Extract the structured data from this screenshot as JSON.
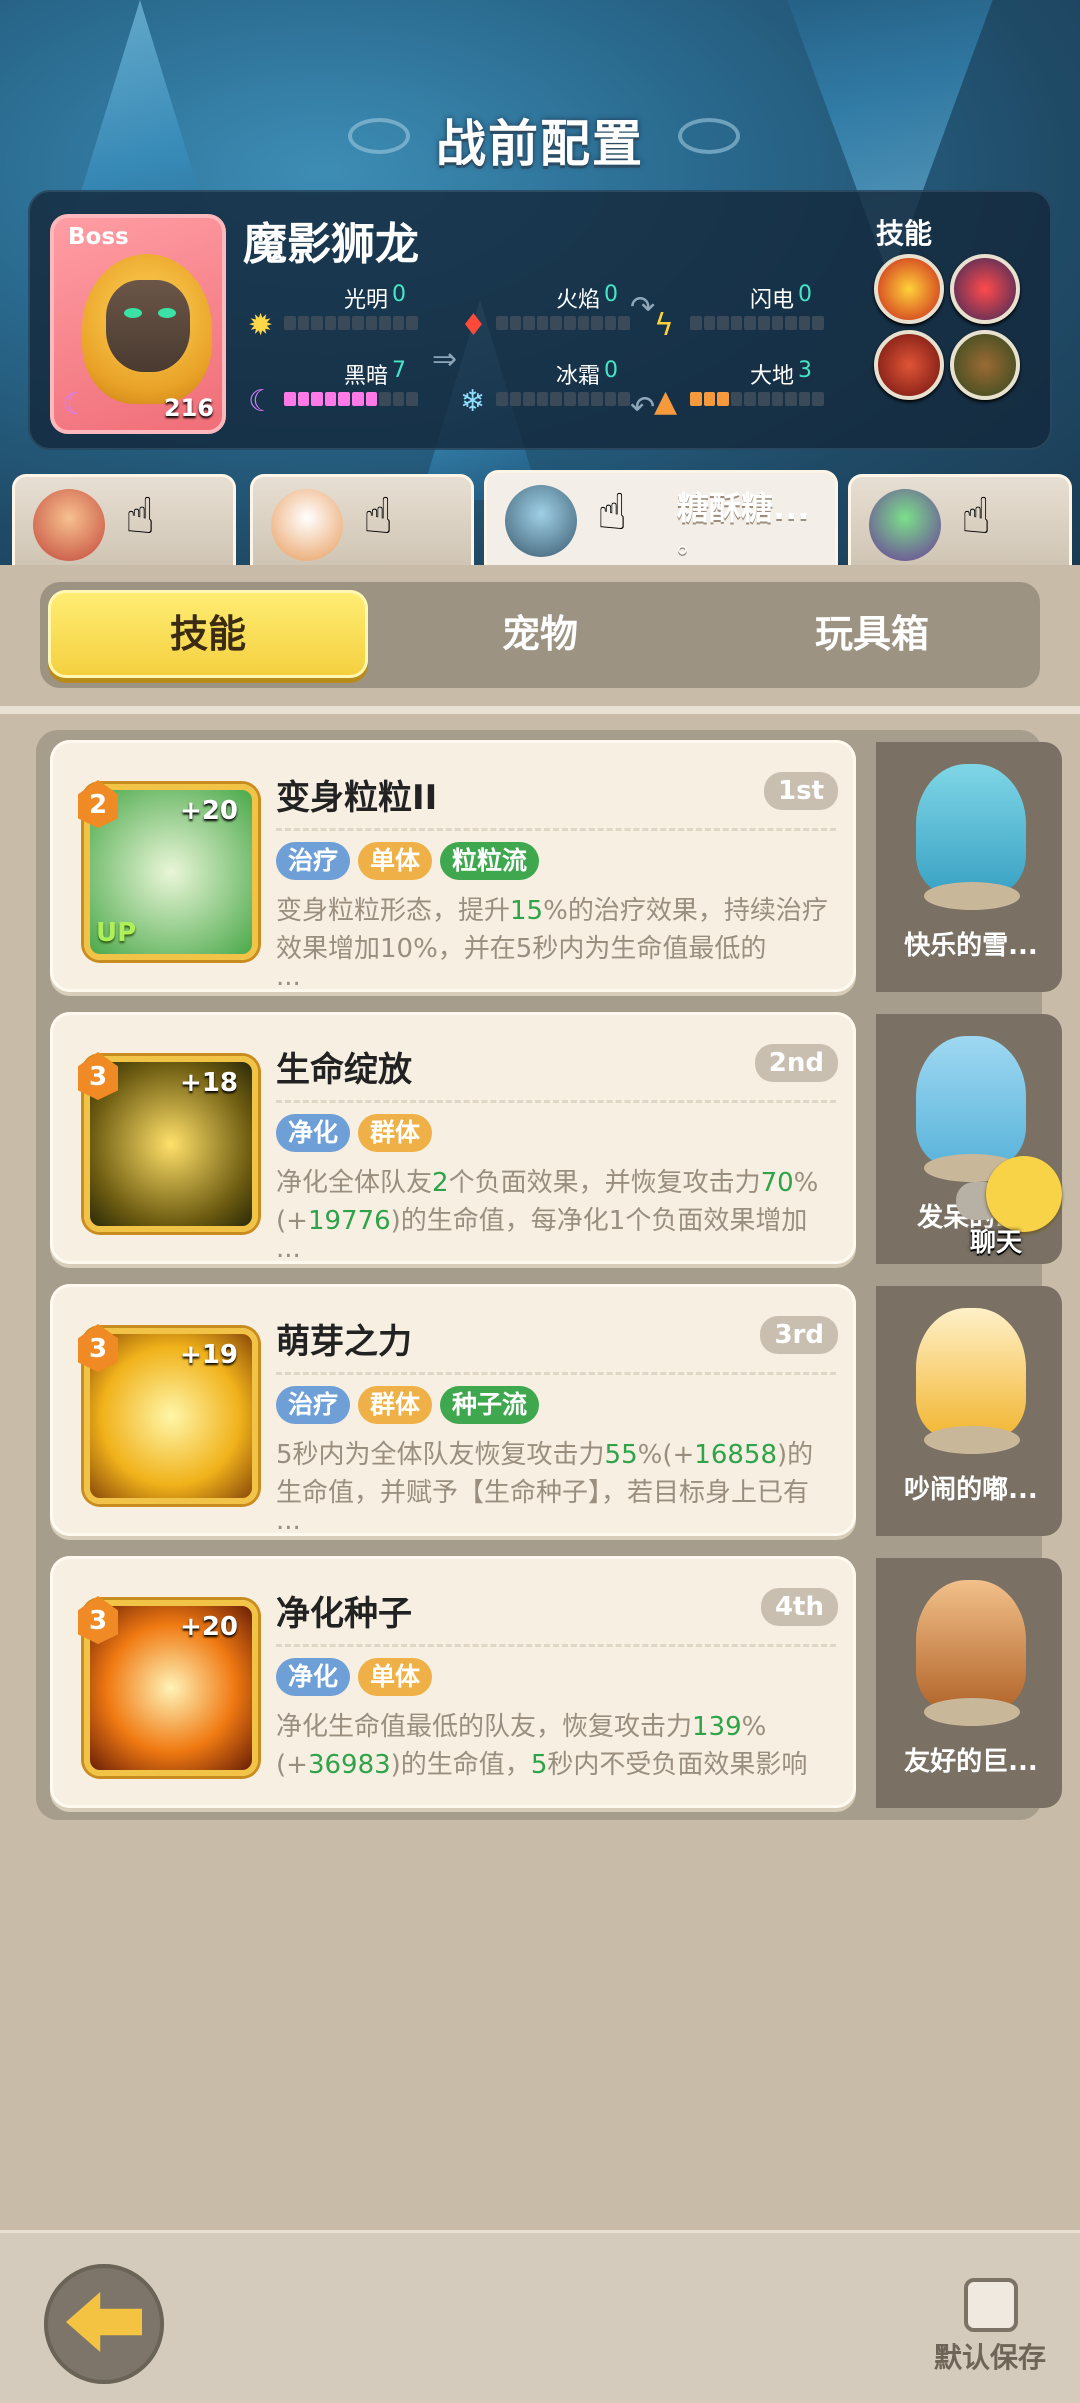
{
  "header": {
    "title": "战前配置"
  },
  "boss": {
    "tag": "Boss",
    "name": "魔影狮龙",
    "level": "216",
    "skills_label": "技能",
    "elements": [
      {
        "label": "光明",
        "value": "0",
        "icon": "sun-icon",
        "fill": 0
      },
      {
        "label": "火焰",
        "value": "0",
        "icon": "fire-icon",
        "fill": 0
      },
      {
        "label": "闪电",
        "value": "0",
        "icon": "lightning-icon",
        "fill": 0
      },
      {
        "label": "黑暗",
        "value": "7",
        "icon": "moon-icon",
        "fill": 7
      },
      {
        "label": "冰霜",
        "value": "0",
        "icon": "snowflake-icon",
        "fill": 0
      },
      {
        "label": "大地",
        "value": "3",
        "icon": "mountain-icon",
        "fill": 3
      }
    ]
  },
  "team": [
    {
      "name": ""
    },
    {
      "name": ""
    },
    {
      "name": "糖酥糖...",
      "sub": "。"
    },
    {
      "name": ""
    }
  ],
  "tabs": [
    {
      "label": "技能"
    },
    {
      "label": "宠物"
    },
    {
      "label": "玩具箱"
    }
  ],
  "skills": [
    {
      "title": "变身粒粒II",
      "rank": "1st",
      "level": "2",
      "plus": "+20",
      "up": "UP",
      "tags": [
        {
          "label": "治疗",
          "color": "blue"
        },
        {
          "label": "单体",
          "color": "orange"
        },
        {
          "label": "粒粒流",
          "color": "green"
        }
      ],
      "desc": [
        "变身粒粒形态，提升",
        "15",
        "%的治疗效果，持续治疗效果增加10%，并在5秒内为生命值最低的"
      ],
      "pet": "快乐的雪..."
    },
    {
      "title": "生命绽放",
      "rank": "2nd",
      "level": "3",
      "plus": "+18",
      "up": "",
      "tags": [
        {
          "label": "净化",
          "color": "blue"
        },
        {
          "label": "群体",
          "color": "orange"
        }
      ],
      "desc": [
        "净化全体队友",
        "2",
        "个负面效果，并恢复攻击力",
        "70",
        "%(+",
        "19776",
        ")的生命值，每净化1个负面效果增加"
      ],
      "pet": "发呆的..."
    },
    {
      "title": "萌芽之力",
      "rank": "3rd",
      "level": "3",
      "plus": "+19",
      "up": "",
      "tags": [
        {
          "label": "治疗",
          "color": "blue"
        },
        {
          "label": "群体",
          "color": "orange"
        },
        {
          "label": "种子流",
          "color": "green"
        }
      ],
      "desc": [
        "5秒内为全体队友恢复攻击力",
        "55",
        "%(+",
        "16858",
        ")的生命值，并赋予【生命种子】，若目标身上已有"
      ],
      "pet": "吵闹的嘟..."
    },
    {
      "title": "净化种子",
      "rank": "4th",
      "level": "3",
      "plus": "+20",
      "up": "",
      "tags": [
        {
          "label": "净化",
          "color": "blue"
        },
        {
          "label": "单体",
          "color": "orange"
        }
      ],
      "desc": [
        "净化生命值最低的队友，恢复攻击力",
        "139",
        "%(+",
        "36983",
        ")的生命值，",
        "5",
        "秒内不受负面效果影响"
      ],
      "pet": "友好的巨..."
    }
  ],
  "chat": {
    "label": "聊天"
  },
  "bottom": {
    "save_label": "默认保存"
  },
  "ellipsis": "...",
  "colors": {
    "tab_active": "#f4cf3e",
    "tag_blue": "#6e9fd6",
    "tag_orange": "#efb048",
    "tag_green": "#3fa84f",
    "highlight_green": "#2ea34a"
  }
}
